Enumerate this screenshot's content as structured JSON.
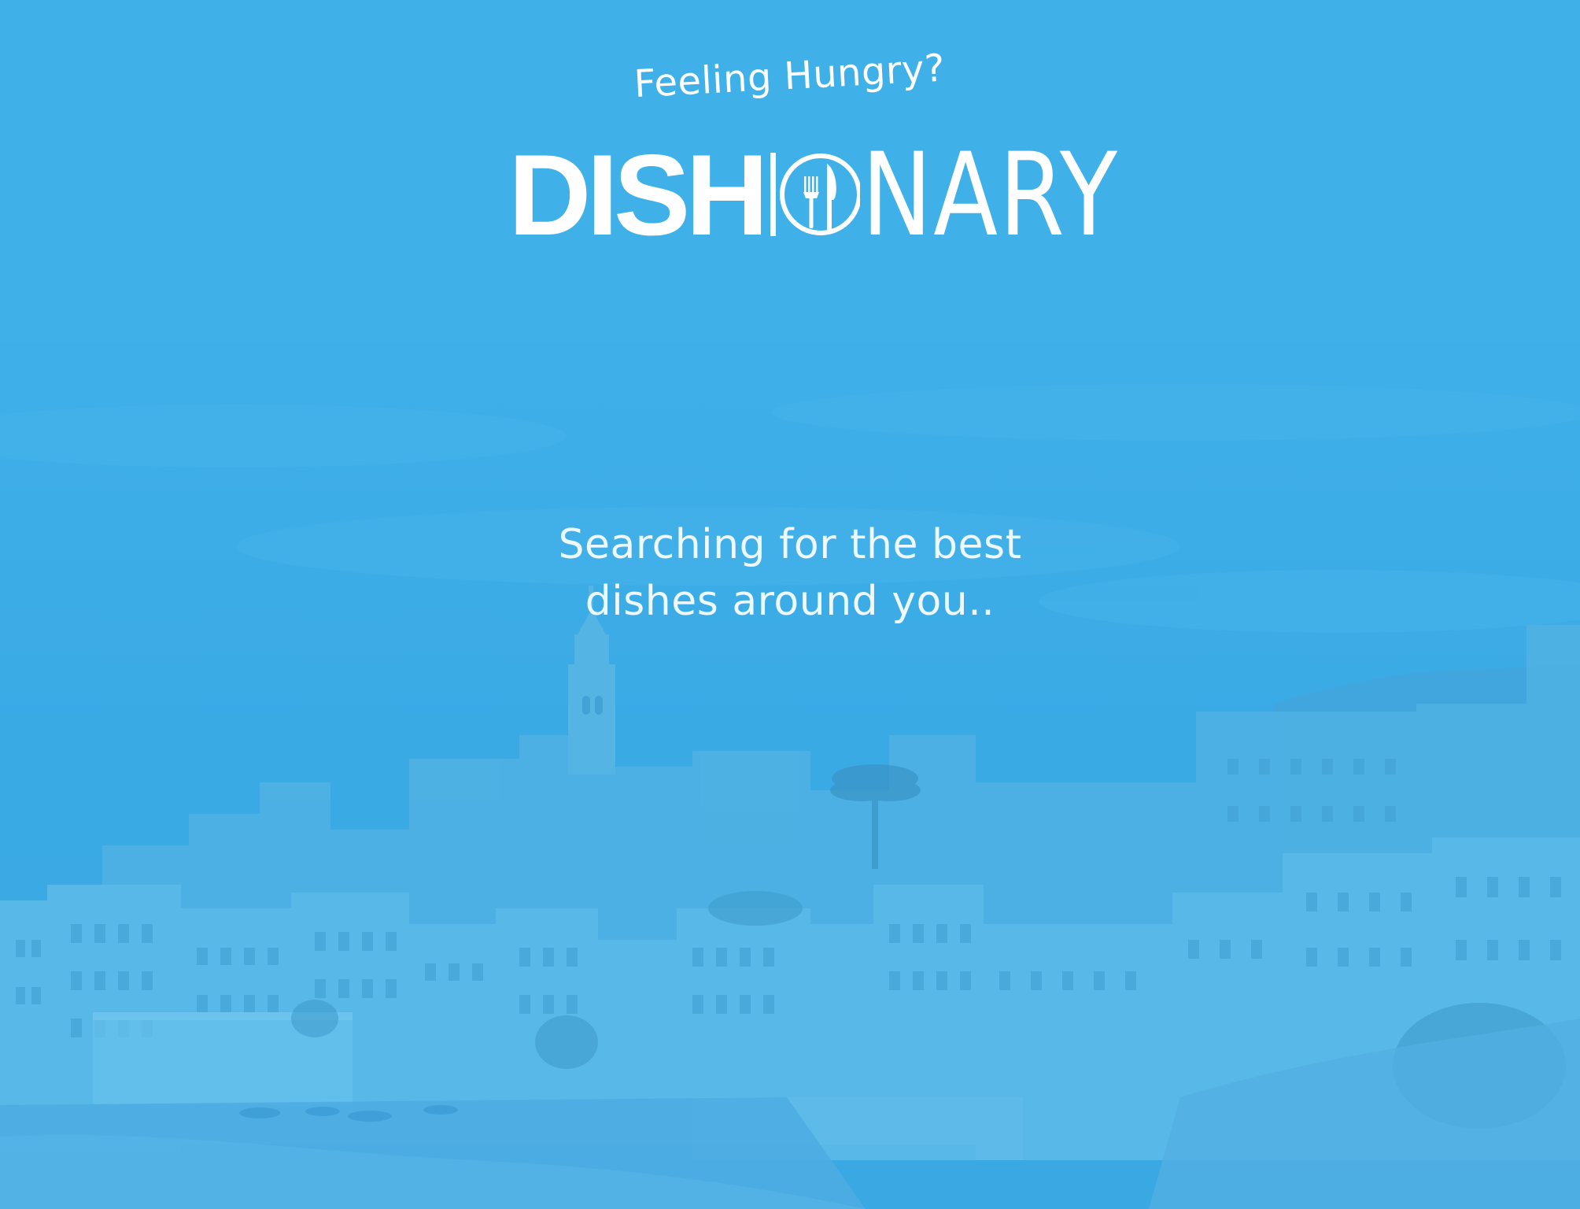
{
  "app": {
    "tagline": "Feeling Hungry?",
    "logo": {
      "bold_part": "DISH",
      "light_part": "NARY",
      "mark_icon": "fork-and-knife-plate-icon"
    }
  },
  "loading": {
    "line1": "Searching for the best",
    "line2": "dishes around you.."
  },
  "colors": {
    "brand_blue": "#3fb1e8",
    "text": "#ffffff"
  }
}
